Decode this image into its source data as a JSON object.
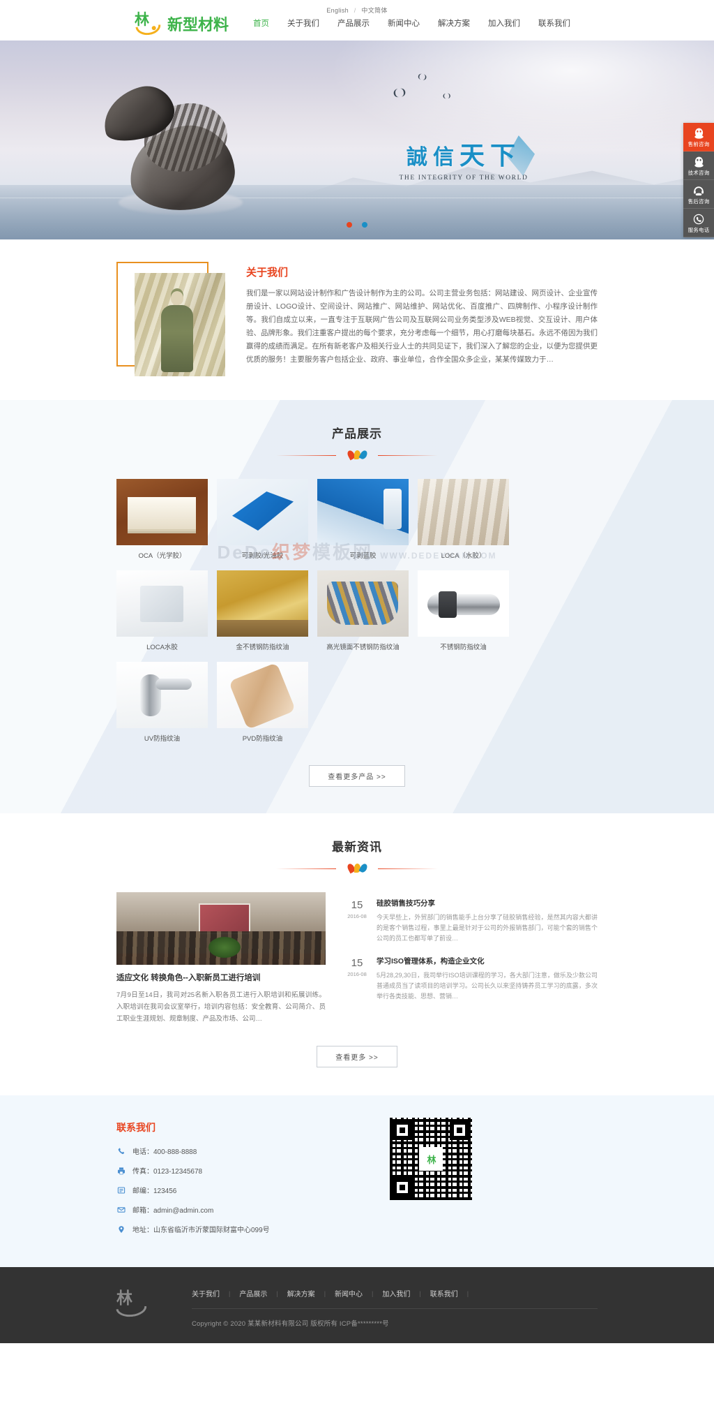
{
  "header": {
    "lang": {
      "english": "English",
      "separator": "/",
      "chinese": "中文简体"
    },
    "logo": {
      "glyph": "林",
      "text": "新型材料"
    },
    "nav": [
      {
        "label": "首页",
        "active": true
      },
      {
        "label": "关于我们",
        "active": false
      },
      {
        "label": "产品展示",
        "active": false
      },
      {
        "label": "新闻中心",
        "active": false
      },
      {
        "label": "解决方案",
        "active": false
      },
      {
        "label": "加入我们",
        "active": false
      },
      {
        "label": "联系我们",
        "active": false
      }
    ]
  },
  "hero": {
    "slogan_cn_1": "誠信",
    "slogan_cn_2": "天下",
    "slogan_en": "THE INTEGRITY OF THE WORLD",
    "dots": [
      "slide-1",
      "slide-2"
    ]
  },
  "sidebar": {
    "items": [
      {
        "label": "售前咨询",
        "icon": "qq-penguin-icon",
        "active": true
      },
      {
        "label": "技术咨询",
        "icon": "qq-penguin-icon",
        "active": false
      },
      {
        "label": "售后咨询",
        "icon": "headset-icon",
        "active": false
      },
      {
        "label": "服务电话",
        "icon": "phone-icon",
        "active": false
      }
    ]
  },
  "about": {
    "title": "关于我们",
    "body": "我们是一家以网站设计制作和广告设计制作为主的公司。公司主营业务包括：网站建设、网页设计、企业宣传册设计、LOGO设计、空间设计、网站推广、网站维护、网站优化、百度推广、四牌制作、小程序设计制作等。我们自成立以来，一直专注于互联网广告公司及互联网公司业务类型涉及WEB视觉、交互设计、用户体验、品牌形象。我们注重客户提出的每个要求，充分考虑每一个细节，用心打磨每块基石。永远不倦因为我们赢得的成绩而满足。在所有新老客户及相关行业人士的共同见证下，我们深入了解您的企业，以便为您提供更优质的服务！主要服务客户包括企业、政府、事业单位，合作全国众多企业，某某传媒致力于…"
  },
  "products": {
    "title": "产品展示",
    "watermark_1": "DeDe",
    "watermark_2": "织梦",
    "watermark_3": "模板网",
    "watermark_sub": "WWW.DEDEYUAN.COM",
    "items": [
      {
        "caption": "OCA（光学胶）",
        "art": "pi-oca"
      },
      {
        "caption": "可剥胶/光油胶",
        "art": "pi-blue1"
      },
      {
        "caption": "可剥蓝胶",
        "art": "pi-blue2"
      },
      {
        "caption": "LOCA（水胶）",
        "art": "pi-loca"
      },
      {
        "caption": "LOCA水胶",
        "art": "pi-locaw"
      },
      {
        "caption": "金不锈钢防指纹油",
        "art": "pi-gold"
      },
      {
        "caption": "高光镜面不锈钢防指纹油",
        "art": "pi-mirror"
      },
      {
        "caption": "不锈钢防指纹油",
        "art": "pi-steel"
      },
      {
        "caption": "UV防指纹油",
        "art": "pi-uv"
      },
      {
        "caption": "PVD防指纹油",
        "art": "pi-pvd"
      }
    ],
    "more_label": "查看更多产品 >>"
  },
  "news": {
    "title": "最新资讯",
    "feature": {
      "title": "适应文化 转换角色--入职新员工进行培训",
      "body": "7月9日至14日，我司对25名新入职各员工进行入职培训和拓展训练。 入职培训在我司会议室举行，培训内容包括：安全教育、公司简介、员工职业生涯规划、规章制度、产品及市场、公司…"
    },
    "list": [
      {
        "day": "15",
        "ym": "2016-08",
        "title": "硅胶销售技巧分享",
        "desc": "今天早些上，外贸部门的销售能手上台分享了硅胶销售经验，是然其内容大都讲的是客个销售过程，事里上最是针对于公司的外报销售部门，可能个套的销售个公司的员工也都写单了前设…"
      },
      {
        "day": "15",
        "ym": "2016-08",
        "title": "学习ISO管理体系，构造企业文化",
        "desc": "5月28,29,30日，我司举行ISO培训课程的学习，各大部门注意，做乐及少数公司普通成员当了读项目的培训学习。公司长久以来坚持铸养员工学习的底露，多次举行各类技能、思想、营销…"
      }
    ],
    "more_label": "查看更多 >>"
  },
  "contact": {
    "title": "联系我们",
    "rows": [
      {
        "icon": "phone-icon",
        "text": "电话：400-888-8888"
      },
      {
        "icon": "fax-icon",
        "text": "传真：0123-12345678"
      },
      {
        "icon": "postcode-icon",
        "text": "邮编：123456"
      },
      {
        "icon": "mail-icon",
        "text": "邮箱：admin@admin.com"
      },
      {
        "icon": "location-icon",
        "text": "地址：山东省临沂市沂蒙国际财富中心099号"
      }
    ],
    "qr_logo": "林"
  },
  "footer": {
    "logo": {
      "glyph": "林"
    },
    "nav": [
      "关于我们",
      "产品展示",
      "解决方案",
      "新闻中心",
      "加入我们",
      "联系我们"
    ],
    "separator": "|",
    "copyright": "Copyright © 2020 某某新材料有限公司 版权所有   ICP备*********号"
  }
}
